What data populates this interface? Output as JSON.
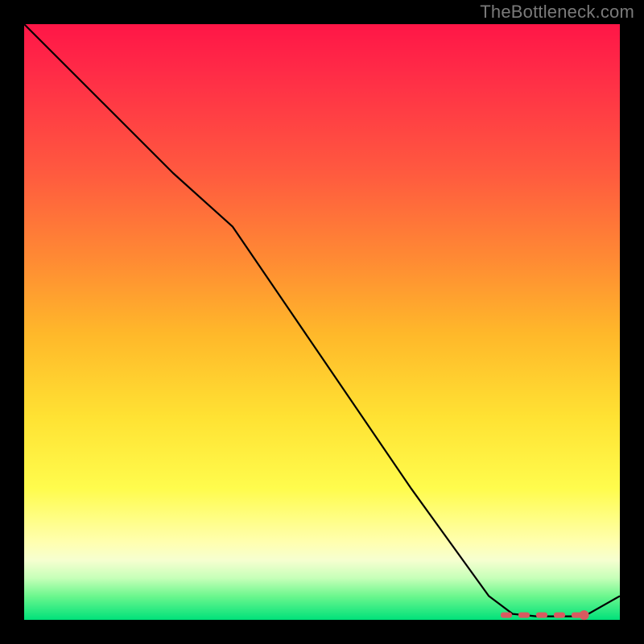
{
  "watermark": "TheBottleneck.com",
  "colors": {
    "background": "#000000",
    "gradient_top": "#ff1647",
    "gradient_bottom": "#00e17a",
    "curve": "#000000",
    "highlight": "#d85a60",
    "watermark_text": "#7a7a7a"
  },
  "chart_data": {
    "type": "line",
    "title": "",
    "xlabel": "",
    "ylabel": "",
    "xlim": [
      0,
      100
    ],
    "ylim": [
      0,
      100
    ],
    "grid": false,
    "series": [
      {
        "name": "bottleneck-curve",
        "x": [
          0,
          10,
          25,
          35,
          50,
          65,
          78,
          82,
          86,
          90,
          94,
          100
        ],
        "y": [
          100,
          90,
          75,
          66,
          44,
          22,
          4,
          1,
          0.6,
          0.6,
          0.6,
          4
        ]
      }
    ],
    "annotations": [
      {
        "name": "optimal-region-dashes",
        "kind": "dashed-segment",
        "x_start": 80,
        "x_end": 94,
        "y": 0.8
      },
      {
        "name": "end-marker",
        "kind": "dot",
        "x": 94,
        "y": 0.8
      }
    ]
  }
}
